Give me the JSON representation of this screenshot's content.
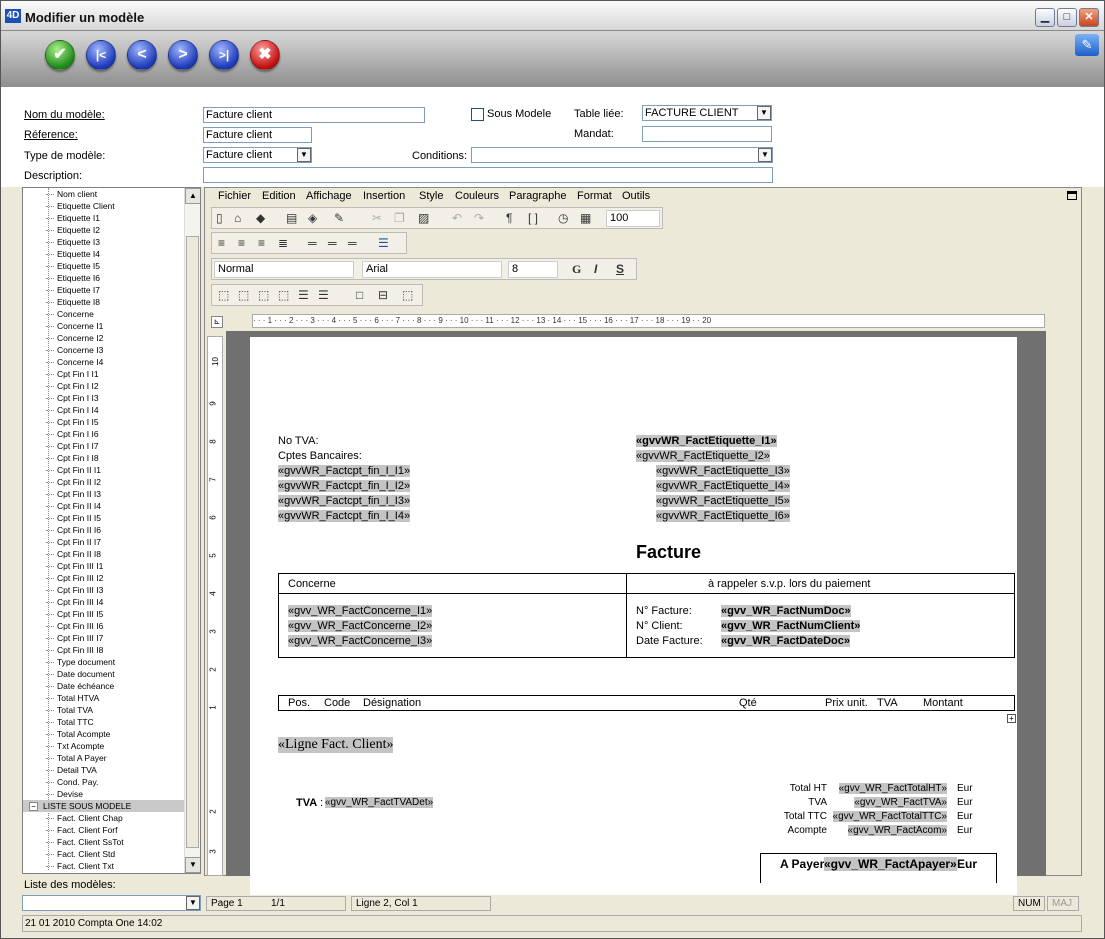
{
  "window": {
    "title": "Modifier un modèle",
    "app_icon": "4D"
  },
  "nav": {
    "validate": "✔",
    "first": "|<",
    "prev": "<",
    "next": ">",
    "last": ">|",
    "cancel": "✖"
  },
  "form": {
    "nom_label": "Nom du modèle:",
    "nom_value": "Facture client",
    "reference_label": "Réference:",
    "reference_value": "Facture client",
    "type_label": "Type de modèle:",
    "type_value": "Facture client",
    "description_label": "Description:",
    "description_value": "",
    "sous_modele_label": "Sous Modele",
    "table_liee_label": "Table liée:",
    "table_liee_value": "FACTURE CLIENT",
    "mandat_label": "Mandat:",
    "mandat_value": "",
    "conditions_label": "Conditions:",
    "conditions_value": ""
  },
  "tree": {
    "items": [
      "Nom client",
      "Etiquette Client",
      "Etiquette I1",
      "Etiquette I2",
      "Etiquette I3",
      "Etiquette I4",
      "Etiquette I5",
      "Etiquette I6",
      "Etiquette I7",
      "Etiquette I8",
      "Concerne",
      "Concerne I1",
      "Concerne I2",
      "Concerne I3",
      "Concerne I4",
      "Cpt Fin I I1",
      "Cpt Fin I I2",
      "Cpt Fin I I3",
      "Cpt Fin I I4",
      "Cpt Fin I I5",
      "Cpt Fin I I6",
      "Cpt Fin I I7",
      "Cpt Fin I I8",
      "Cpt Fin II I1",
      "Cpt Fin II I2",
      "Cpt Fin II I3",
      "Cpt Fin II I4",
      "Cpt Fin II I5",
      "Cpt Fin II I6",
      "Cpt Fin II I7",
      "Cpt Fin II I8",
      "Cpt Fin III I1",
      "Cpt Fin III I2",
      "Cpt Fin III I3",
      "Cpt Fin III I4",
      "Cpt Fin III I5",
      "Cpt Fin III I6",
      "Cpt Fin III I7",
      "Cpt Fin III I8",
      "Type document",
      "Date document",
      "Date échéance",
      "Total HTVA",
      "Total TVA",
      "Total TTC",
      "Total Acompte",
      "Txt Acompte",
      "Total A Payer",
      "Detail TVA",
      "Cond. Pay.",
      "Devise"
    ],
    "group_label": "LISTE SOUS MODELE",
    "group_toggle": "−",
    "sub_items": [
      "Fact. Client Chap",
      "Fact. Client Forf",
      "Fact. Client SsTot",
      "Fact. Client Std",
      "Fact. Client Txt"
    ]
  },
  "liste_modeles_label": "Liste des modèles:",
  "liste_modeles_value": "",
  "editor": {
    "menu": [
      "Fichier",
      "Edition",
      "Affichage",
      "Insertion",
      "Style",
      "Couleurs",
      "Paragraphe",
      "Format",
      "Outils"
    ],
    "zoom": "100",
    "style": "Normal",
    "font": "Arial",
    "size": "8",
    "bold": "G",
    "italic": "I",
    "underline": "S",
    "ruler_text": "·  ·  ·  1  ·  ·  ·  2  ·  ·  ·  3  ·  ·  ·  4  ·  ·  ·  5  ·  ·  ·  6  ·  ·  ·  7  ·  ·  ·  8  ·  ·  ·  9  ·  ·  ·  10  ·  ·  ·  11  ·  ·  ·  12  ·  ·  ·  13  ·  14  ·  ·  ·  15  ·  ·  ·  16  ·  ·  ·  17  ·  ·  ·  18  ·  ·  ·  19  ·  ·  20"
  },
  "doc": {
    "no_tva": "No TVA:",
    "cptes": "Cptes Bancaires:",
    "cpt_fields": [
      "«gvvWR_Factcpt_fin_I_I1»",
      "«gvvWR_Factcpt_fin_I_I2»",
      "«gvvWR_Factcpt_fin_I_I3»",
      "«gvvWR_Factcpt_fin_I_I4»"
    ],
    "etiq1": "«gvvWR_FactEtiquette_I1»",
    "etiq_fields": [
      "«gvvWR_FactEtiquette_I2»",
      "«gvvWR_FactEtiquette_I3»",
      "«gvvWR_FactEtiquette_I4»",
      "«gvvWR_FactEtiquette_I5»",
      "«gvvWR_FactEtiquette_I6»"
    ],
    "title": "Facture",
    "concerne": "Concerne",
    "rappeler": "à rappeler s.v.p. lors du paiement",
    "concerne_fields": [
      "«gvv_WR_FactConcerne_I1»",
      "«gvv_WR_FactConcerne_I2»",
      "«gvv_WR_FactConcerne_I3»"
    ],
    "nfacture_label": "N° Facture:",
    "nfacture_val": "«gvv_WR_FactNumDoc»",
    "nclient_label": "N° Client:",
    "nclient_val": "«gvv_WR_FactNumClient»",
    "date_label": "Date Facture:",
    "date_val": "«gvv_WR_FactDateDoc»",
    "cols": {
      "pos": "Pos.",
      "code": "Code",
      "designation": "Désignation",
      "qte": "Qté",
      "prix": "Prix unit.",
      "tva": "TVA",
      "montant": "Montant"
    },
    "ligne": "«Ligne Fact. Client»",
    "tva_label": "TVA",
    "tva_sep": ":",
    "tva_det": "«gvv_WR_FactTVADet»",
    "totals": [
      {
        "label": "Total HT",
        "val": "«gvv_WR_FactTotalHT»",
        "cur": "Eur"
      },
      {
        "label": "TVA",
        "val": "«gvv_WR_FactTVA»",
        "cur": "Eur"
      },
      {
        "label": "Total TTC",
        "val": "«gvv_WR_FactTotalTTC»",
        "cur": "Eur"
      },
      {
        "label": "Acompte",
        "val": "«gvv_WR_FactAcom»",
        "cur": "Eur"
      }
    ],
    "apayer_label": "A Payer",
    "apayer_val": "«gvv_WR_FactApayer»",
    "apayer_cur": "Eur"
  },
  "status": {
    "page": "Page 1",
    "pages": "1/1",
    "pos": "Ligne 2, Col 1",
    "num": "NUM",
    "maj": "MAJ"
  },
  "footer": "21 01 2010 Compta One 14:02"
}
